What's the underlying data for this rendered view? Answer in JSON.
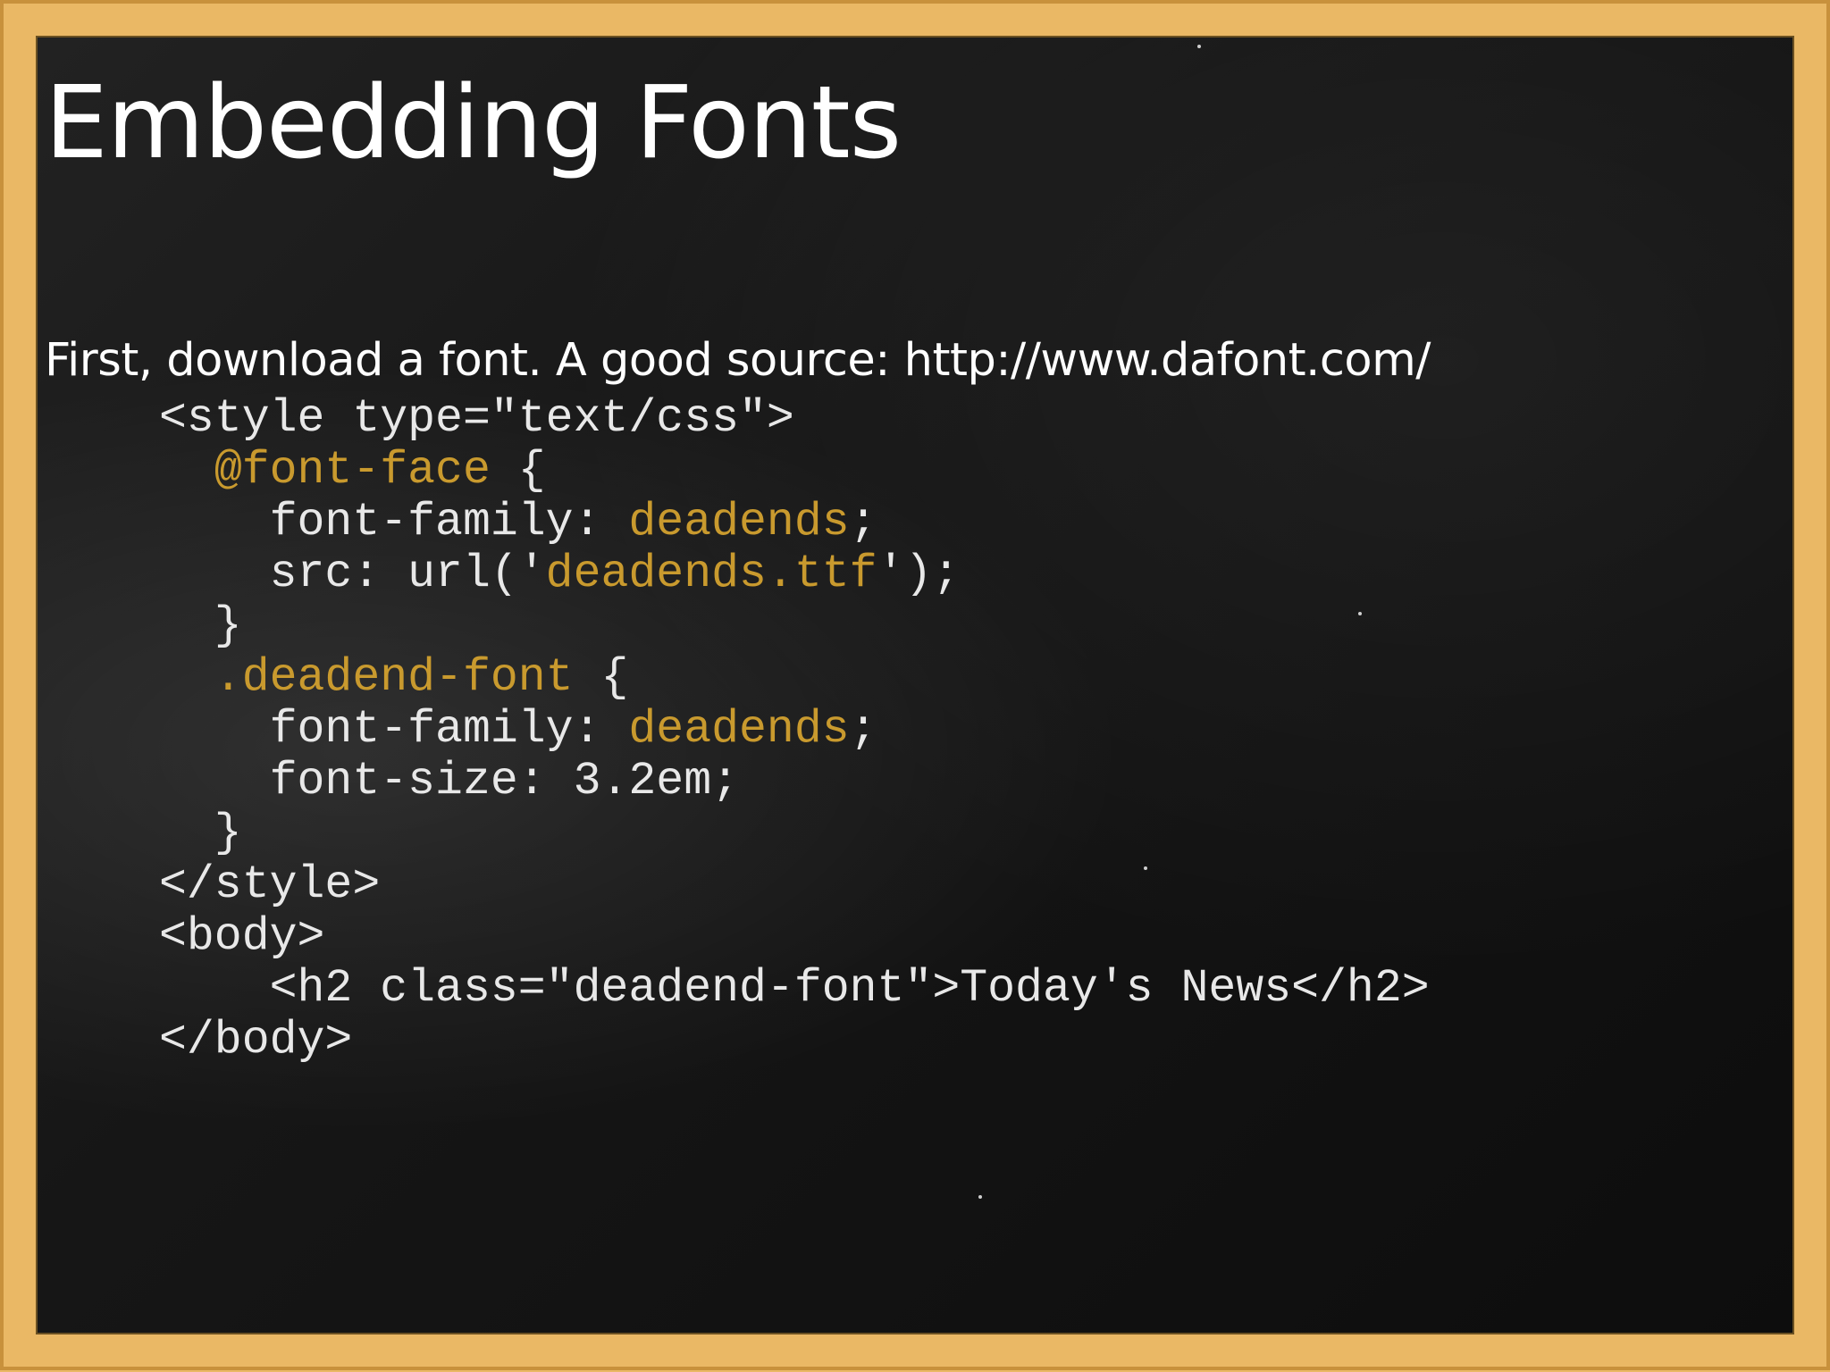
{
  "slide": {
    "title": "Embedding Fonts",
    "intro": "First, download a font. A good source: http://www.dafont.com/"
  },
  "code": {
    "lines": [
      [
        {
          "t": "<style type=\"text/css\">"
        }
      ],
      [
        {
          "t": "  "
        },
        {
          "t": "@font-face",
          "hl": true
        },
        {
          "t": " {"
        }
      ],
      [
        {
          "t": "    font-family: "
        },
        {
          "t": "deadends",
          "hl": true
        },
        {
          "t": ";"
        }
      ],
      [
        {
          "t": "    src: url('"
        },
        {
          "t": "deadends.ttf",
          "hl": true
        },
        {
          "t": "');"
        }
      ],
      [
        {
          "t": "  }"
        }
      ],
      [
        {
          "t": "  "
        },
        {
          "t": ".deadend-font",
          "hl": true
        },
        {
          "t": " {"
        }
      ],
      [
        {
          "t": "    font-family: "
        },
        {
          "t": "deadends",
          "hl": true
        },
        {
          "t": ";"
        }
      ],
      [
        {
          "t": "    font-size: 3.2em;"
        }
      ],
      [
        {
          "t": "  }"
        }
      ],
      [
        {
          "t": "</style>"
        }
      ],
      [
        {
          "t": "<body>"
        }
      ],
      [
        {
          "t": "    <h2 class=\"deadend-font\">Today's News</h2>"
        }
      ],
      [
        {
          "t": "</body>"
        }
      ]
    ]
  },
  "colors": {
    "frame": "#eab865",
    "board": "#161616",
    "text": "#ffffff",
    "code_text": "#e8e8e8",
    "code_highlight": "#c99a2e"
  }
}
